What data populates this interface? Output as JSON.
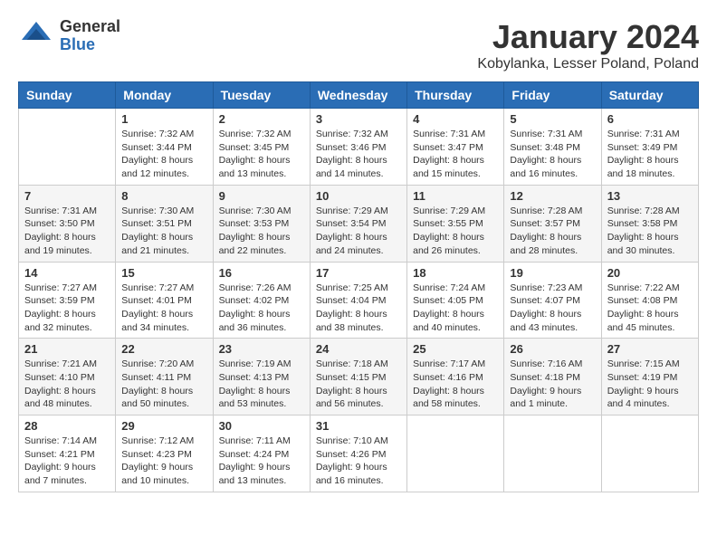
{
  "header": {
    "logo_general": "General",
    "logo_blue": "Blue",
    "title": "January 2024",
    "subtitle": "Kobylanka, Lesser Poland, Poland"
  },
  "calendar": {
    "days_of_week": [
      "Sunday",
      "Monday",
      "Tuesday",
      "Wednesday",
      "Thursday",
      "Friday",
      "Saturday"
    ],
    "weeks": [
      [
        {
          "day": "",
          "sunrise": "",
          "sunset": "",
          "daylight": ""
        },
        {
          "day": "1",
          "sunrise": "Sunrise: 7:32 AM",
          "sunset": "Sunset: 3:44 PM",
          "daylight": "Daylight: 8 hours and 12 minutes."
        },
        {
          "day": "2",
          "sunrise": "Sunrise: 7:32 AM",
          "sunset": "Sunset: 3:45 PM",
          "daylight": "Daylight: 8 hours and 13 minutes."
        },
        {
          "day": "3",
          "sunrise": "Sunrise: 7:32 AM",
          "sunset": "Sunset: 3:46 PM",
          "daylight": "Daylight: 8 hours and 14 minutes."
        },
        {
          "day": "4",
          "sunrise": "Sunrise: 7:31 AM",
          "sunset": "Sunset: 3:47 PM",
          "daylight": "Daylight: 8 hours and 15 minutes."
        },
        {
          "day": "5",
          "sunrise": "Sunrise: 7:31 AM",
          "sunset": "Sunset: 3:48 PM",
          "daylight": "Daylight: 8 hours and 16 minutes."
        },
        {
          "day": "6",
          "sunrise": "Sunrise: 7:31 AM",
          "sunset": "Sunset: 3:49 PM",
          "daylight": "Daylight: 8 hours and 18 minutes."
        }
      ],
      [
        {
          "day": "7",
          "sunrise": "Sunrise: 7:31 AM",
          "sunset": "Sunset: 3:50 PM",
          "daylight": "Daylight: 8 hours and 19 minutes."
        },
        {
          "day": "8",
          "sunrise": "Sunrise: 7:30 AM",
          "sunset": "Sunset: 3:51 PM",
          "daylight": "Daylight: 8 hours and 21 minutes."
        },
        {
          "day": "9",
          "sunrise": "Sunrise: 7:30 AM",
          "sunset": "Sunset: 3:53 PM",
          "daylight": "Daylight: 8 hours and 22 minutes."
        },
        {
          "day": "10",
          "sunrise": "Sunrise: 7:29 AM",
          "sunset": "Sunset: 3:54 PM",
          "daylight": "Daylight: 8 hours and 24 minutes."
        },
        {
          "day": "11",
          "sunrise": "Sunrise: 7:29 AM",
          "sunset": "Sunset: 3:55 PM",
          "daylight": "Daylight: 8 hours and 26 minutes."
        },
        {
          "day": "12",
          "sunrise": "Sunrise: 7:28 AM",
          "sunset": "Sunset: 3:57 PM",
          "daylight": "Daylight: 8 hours and 28 minutes."
        },
        {
          "day": "13",
          "sunrise": "Sunrise: 7:28 AM",
          "sunset": "Sunset: 3:58 PM",
          "daylight": "Daylight: 8 hours and 30 minutes."
        }
      ],
      [
        {
          "day": "14",
          "sunrise": "Sunrise: 7:27 AM",
          "sunset": "Sunset: 3:59 PM",
          "daylight": "Daylight: 8 hours and 32 minutes."
        },
        {
          "day": "15",
          "sunrise": "Sunrise: 7:27 AM",
          "sunset": "Sunset: 4:01 PM",
          "daylight": "Daylight: 8 hours and 34 minutes."
        },
        {
          "day": "16",
          "sunrise": "Sunrise: 7:26 AM",
          "sunset": "Sunset: 4:02 PM",
          "daylight": "Daylight: 8 hours and 36 minutes."
        },
        {
          "day": "17",
          "sunrise": "Sunrise: 7:25 AM",
          "sunset": "Sunset: 4:04 PM",
          "daylight": "Daylight: 8 hours and 38 minutes."
        },
        {
          "day": "18",
          "sunrise": "Sunrise: 7:24 AM",
          "sunset": "Sunset: 4:05 PM",
          "daylight": "Daylight: 8 hours and 40 minutes."
        },
        {
          "day": "19",
          "sunrise": "Sunrise: 7:23 AM",
          "sunset": "Sunset: 4:07 PM",
          "daylight": "Daylight: 8 hours and 43 minutes."
        },
        {
          "day": "20",
          "sunrise": "Sunrise: 7:22 AM",
          "sunset": "Sunset: 4:08 PM",
          "daylight": "Daylight: 8 hours and 45 minutes."
        }
      ],
      [
        {
          "day": "21",
          "sunrise": "Sunrise: 7:21 AM",
          "sunset": "Sunset: 4:10 PM",
          "daylight": "Daylight: 8 hours and 48 minutes."
        },
        {
          "day": "22",
          "sunrise": "Sunrise: 7:20 AM",
          "sunset": "Sunset: 4:11 PM",
          "daylight": "Daylight: 8 hours and 50 minutes."
        },
        {
          "day": "23",
          "sunrise": "Sunrise: 7:19 AM",
          "sunset": "Sunset: 4:13 PM",
          "daylight": "Daylight: 8 hours and 53 minutes."
        },
        {
          "day": "24",
          "sunrise": "Sunrise: 7:18 AM",
          "sunset": "Sunset: 4:15 PM",
          "daylight": "Daylight: 8 hours and 56 minutes."
        },
        {
          "day": "25",
          "sunrise": "Sunrise: 7:17 AM",
          "sunset": "Sunset: 4:16 PM",
          "daylight": "Daylight: 8 hours and 58 minutes."
        },
        {
          "day": "26",
          "sunrise": "Sunrise: 7:16 AM",
          "sunset": "Sunset: 4:18 PM",
          "daylight": "Daylight: 9 hours and 1 minute."
        },
        {
          "day": "27",
          "sunrise": "Sunrise: 7:15 AM",
          "sunset": "Sunset: 4:19 PM",
          "daylight": "Daylight: 9 hours and 4 minutes."
        }
      ],
      [
        {
          "day": "28",
          "sunrise": "Sunrise: 7:14 AM",
          "sunset": "Sunset: 4:21 PM",
          "daylight": "Daylight: 9 hours and 7 minutes."
        },
        {
          "day": "29",
          "sunrise": "Sunrise: 7:12 AM",
          "sunset": "Sunset: 4:23 PM",
          "daylight": "Daylight: 9 hours and 10 minutes."
        },
        {
          "day": "30",
          "sunrise": "Sunrise: 7:11 AM",
          "sunset": "Sunset: 4:24 PM",
          "daylight": "Daylight: 9 hours and 13 minutes."
        },
        {
          "day": "31",
          "sunrise": "Sunrise: 7:10 AM",
          "sunset": "Sunset: 4:26 PM",
          "daylight": "Daylight: 9 hours and 16 minutes."
        },
        {
          "day": "",
          "sunrise": "",
          "sunset": "",
          "daylight": ""
        },
        {
          "day": "",
          "sunrise": "",
          "sunset": "",
          "daylight": ""
        },
        {
          "day": "",
          "sunrise": "",
          "sunset": "",
          "daylight": ""
        }
      ]
    ]
  }
}
